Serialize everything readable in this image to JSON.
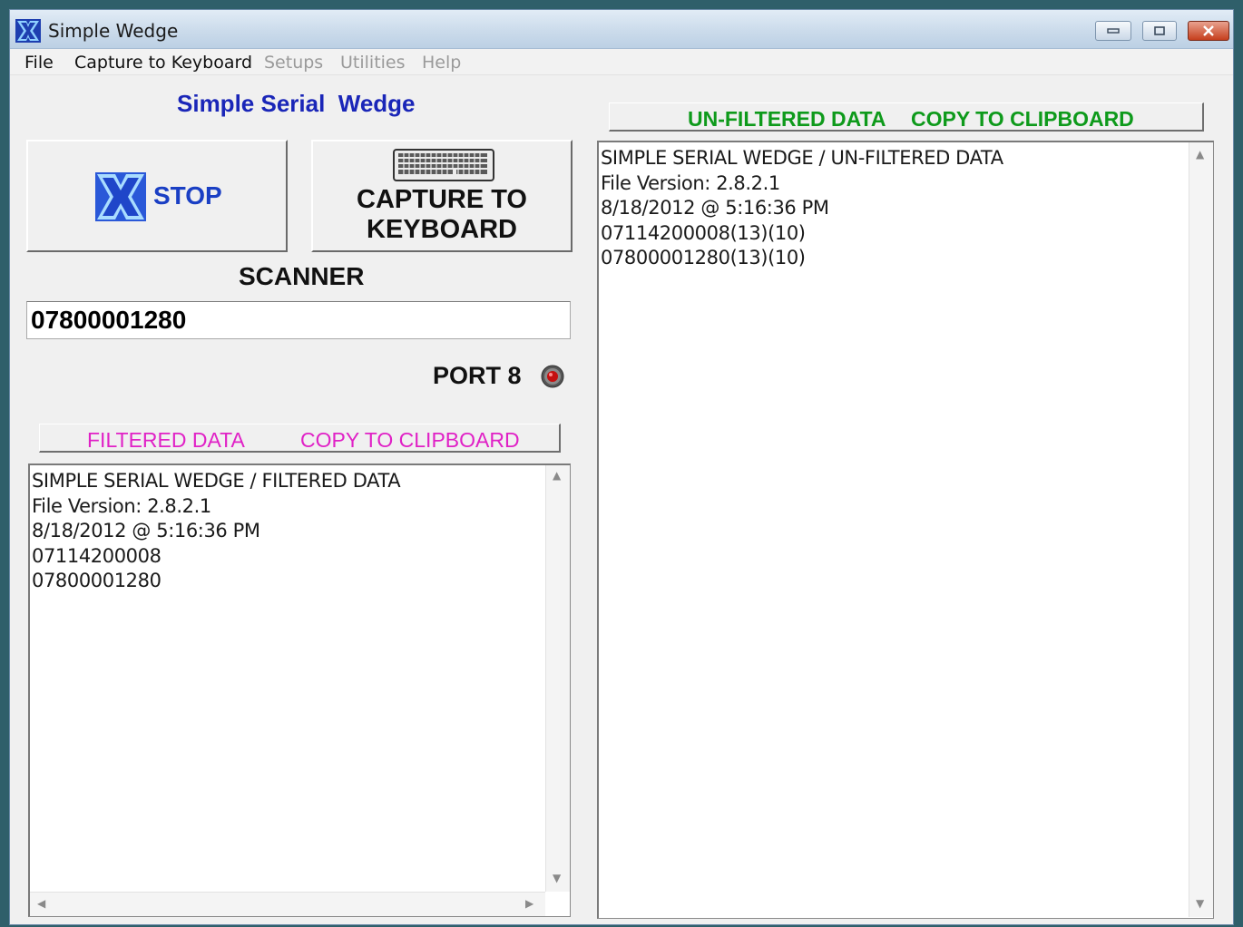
{
  "window": {
    "title": "Simple Wedge"
  },
  "menu": {
    "items": [
      {
        "label": "File",
        "enabled": true
      },
      {
        "label": "Capture to Keyboard",
        "enabled": true
      },
      {
        "label": "Setups",
        "enabled": false
      },
      {
        "label": "Utilities",
        "enabled": false
      },
      {
        "label": "Help",
        "enabled": false
      }
    ]
  },
  "left": {
    "heading": "Simple Serial  Wedge",
    "stop_button": {
      "label": "STOP",
      "icon": "stop-x-icon"
    },
    "capture_button": {
      "label": "CAPTURE TO\nKEYBOARD",
      "icon": "keyboard-icon"
    },
    "scanner_label": "SCANNER",
    "scanner_value": "07800001280",
    "port_label": "PORT 8",
    "port_led_color": "#c41010",
    "filtered_header": {
      "title": "FILTERED DATA",
      "copy": "COPY TO CLIPBOARD",
      "color": "#e021c6"
    },
    "filtered_lines": [
      "SIMPLE SERIAL WEDGE / FILTERED DATA",
      "File Version: 2.8.2.1",
      "8/18/2012 @ 5:16:36 PM",
      "07114200008",
      "07800001280"
    ]
  },
  "right": {
    "unfiltered_header": {
      "title": "UN-FILTERED DATA",
      "copy": "COPY TO CLIPBOARD",
      "color": "#0e9a1b"
    },
    "unfiltered_lines": [
      "SIMPLE SERIAL WEDGE / UN-FILTERED DATA",
      "File Version: 2.8.2.1",
      "8/18/2012 @ 5:16:36 PM",
      "07114200008(13)(10)",
      "07800001280(13)(10)"
    ]
  }
}
